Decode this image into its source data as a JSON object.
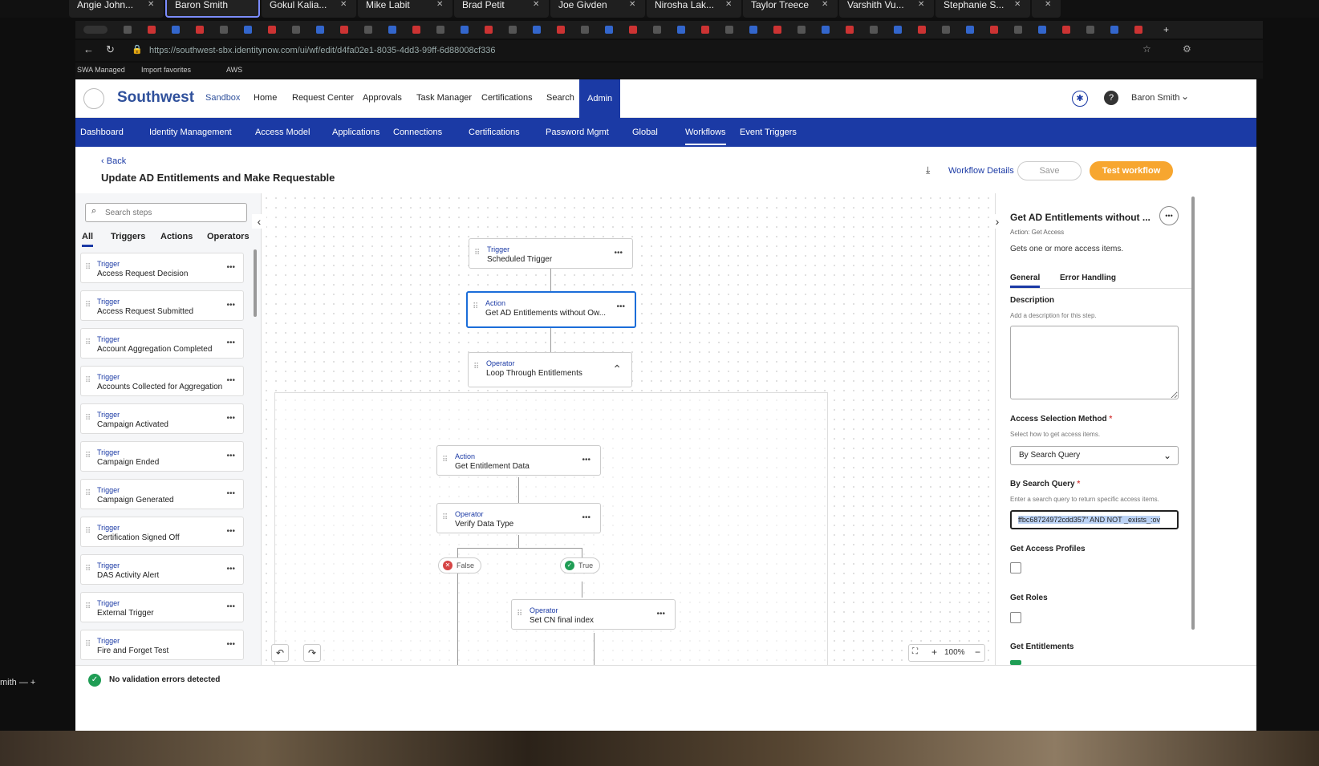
{
  "participants": [
    "Angie John...",
    "Baron Smith",
    "Gokul Kalia...",
    "Mike Labit",
    "Brad Petit",
    "Joe Givden",
    "Nirosha Lak...",
    "Taylor Treece",
    "Varshith Vu...",
    "Stephanie S..."
  ],
  "browser": {
    "url": "https://southwest-sbx.identitynow.com/ui/wf/edit/d4fa02e1-8035-4dd3-99ff-6d88008cf336",
    "favorites": [
      "SWA Managed",
      "Import favorites",
      "AWS"
    ]
  },
  "topnav": {
    "brand": "Southwest",
    "env": "Sandbox",
    "items": [
      "Home",
      "Request Center",
      "Approvals",
      "Task Manager",
      "Certifications",
      "Search",
      "Admin"
    ],
    "user": "Baron Smith"
  },
  "subnav": [
    "Dashboard",
    "Identity Management",
    "Access Model",
    "Applications",
    "Connections",
    "Certifications",
    "Password Mgmt",
    "Global",
    "Workflows",
    "Event Triggers"
  ],
  "header": {
    "back": "Back",
    "title": "Update AD Entitlements and Make Requestable",
    "details": "Workflow Details",
    "save": "Save",
    "test": "Test workflow"
  },
  "left": {
    "search_placeholder": "Search steps",
    "tabs": [
      "All",
      "Triggers",
      "Actions",
      "Operators"
    ],
    "steps": [
      {
        "kind": "Trigger",
        "name": "Access Request Decision"
      },
      {
        "kind": "Trigger",
        "name": "Access Request Submitted"
      },
      {
        "kind": "Trigger",
        "name": "Account Aggregation Completed"
      },
      {
        "kind": "Trigger",
        "name": "Accounts Collected for Aggregation"
      },
      {
        "kind": "Trigger",
        "name": "Campaign Activated"
      },
      {
        "kind": "Trigger",
        "name": "Campaign Ended"
      },
      {
        "kind": "Trigger",
        "name": "Campaign Generated"
      },
      {
        "kind": "Trigger",
        "name": "Certification Signed Off"
      },
      {
        "kind": "Trigger",
        "name": "DAS Activity Alert"
      },
      {
        "kind": "Trigger",
        "name": "External Trigger"
      },
      {
        "kind": "Trigger",
        "name": "Fire and Forget Test"
      }
    ]
  },
  "canvas": {
    "nodes": [
      {
        "kind": "Trigger",
        "name": "Scheduled Trigger"
      },
      {
        "kind": "Action",
        "name": "Get AD Entitlements without Ow..."
      },
      {
        "kind": "Operator",
        "name": "Loop Through Entitlements"
      },
      {
        "kind": "Action",
        "name": "Get Entitlement Data"
      },
      {
        "kind": "Operator",
        "name": "Verify Data Type"
      },
      {
        "kind": "Operator",
        "name": "Set CN final index"
      }
    ],
    "branch_false": "False",
    "branch_true": "True",
    "zoom": "100%"
  },
  "right": {
    "title": "Get AD Entitlements without ...",
    "subtitle": "Action: Get Access",
    "description": "Gets one or more access items.",
    "tabs": [
      "General",
      "Error Handling"
    ],
    "desc_label": "Description",
    "desc_help": "Add a description for this step.",
    "asm_label": "Access Selection Method",
    "asm_help": "Select how to get access items.",
    "asm_value": "By Search Query",
    "sq_label": "By Search Query",
    "sq_help": "Enter a search query to return specific access items.",
    "sq_value": "ffbc68724972cdd357\" AND NOT _exists_:ov",
    "gap_label": "Get Access Profiles",
    "gr_label": "Get Roles",
    "ge_label": "Get Entitlements"
  },
  "footer": {
    "status": "No validation errors detected"
  },
  "misc": {
    "left_stub": "mith"
  }
}
